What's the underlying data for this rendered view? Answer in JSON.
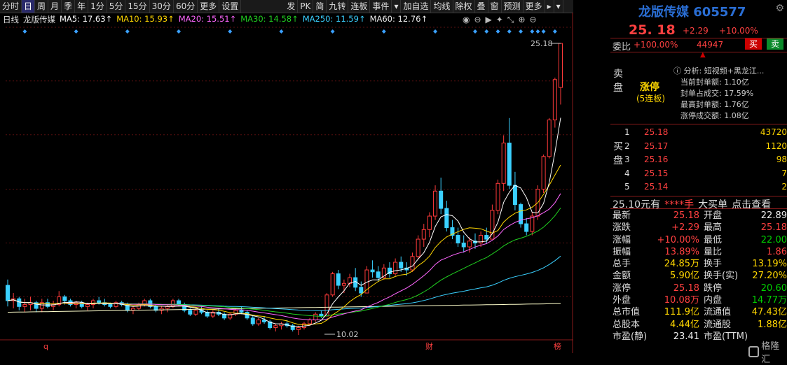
{
  "toolbar": {
    "items": [
      {
        "label": "分时"
      },
      {
        "label": "日",
        "active": true
      },
      {
        "label": "周"
      },
      {
        "label": "月"
      },
      {
        "label": "季"
      },
      {
        "label": "年"
      },
      {
        "label": "1分"
      },
      {
        "label": "5分"
      },
      {
        "label": "15分"
      },
      {
        "label": "30分"
      },
      {
        "label": "60分"
      },
      {
        "label": "更多"
      },
      {
        "label": "设置"
      }
    ],
    "items2": [
      {
        "label": "发"
      },
      {
        "label": "PK"
      },
      {
        "label": "简"
      },
      {
        "label": "九转"
      },
      {
        "label": "连板"
      },
      {
        "label": "事件"
      },
      {
        "label": "▾"
      },
      {
        "label": "加自选"
      },
      {
        "label": "均线"
      },
      {
        "label": "除权"
      },
      {
        "label": "叠"
      },
      {
        "label": "窗"
      },
      {
        "label": "预测"
      },
      {
        "label": "更多"
      },
      {
        "label": "▸"
      },
      {
        "label": "▾"
      }
    ]
  },
  "ma_bar": {
    "period": "日线",
    "stock": "龙版传媒",
    "ma5": "MA5: 17.63↑",
    "ma10": "MA10: 15.93↑",
    "ma20": "MA20: 15.51↑",
    "ma30": "MA30: 14.58↑",
    "ma250": "MA250: 11.59↑",
    "ma60": "MA60: 12.76↑"
  },
  "chart_data": {
    "type": "candlestick",
    "y_ticks": [
      "26.02",
      "23.23",
      "20.43",
      "17.60",
      "14.80",
      "12.01"
    ],
    "ylim": [
      10.02,
      26.02
    ],
    "annotations": {
      "high_label": "25.18",
      "low_label": "10.02",
      "bottom_marks": [
        "q",
        "财",
        "榜"
      ]
    },
    "ohlc": [
      [
        12.6,
        12.9,
        11.5,
        11.8
      ],
      [
        11.8,
        12.2,
        11.4,
        11.9
      ],
      [
        11.9,
        12.0,
        11.3,
        11.5
      ],
      [
        11.5,
        11.9,
        11.2,
        11.6
      ],
      [
        11.6,
        12.0,
        11.3,
        11.7
      ],
      [
        11.7,
        11.8,
        11.2,
        11.4
      ],
      [
        11.4,
        11.9,
        11.2,
        11.7
      ],
      [
        11.7,
        11.9,
        11.4,
        11.5
      ],
      [
        11.5,
        11.8,
        11.3,
        11.6
      ],
      [
        11.6,
        12.3,
        11.5,
        12.0
      ],
      [
        12.0,
        12.1,
        11.6,
        11.8
      ],
      [
        11.8,
        11.9,
        11.5,
        11.6
      ],
      [
        11.6,
        11.8,
        11.4,
        11.7
      ],
      [
        11.7,
        11.8,
        11.4,
        11.5
      ],
      [
        11.5,
        11.7,
        11.3,
        11.6
      ],
      [
        11.6,
        11.9,
        11.4,
        11.8
      ],
      [
        11.8,
        12.0,
        11.6,
        11.7
      ],
      [
        11.7,
        11.9,
        11.5,
        11.6
      ],
      [
        11.6,
        11.7,
        11.4,
        11.5
      ],
      [
        11.5,
        11.8,
        11.4,
        11.7
      ],
      [
        11.7,
        11.8,
        11.5,
        11.6
      ],
      [
        11.6,
        11.7,
        11.2,
        11.3
      ],
      [
        11.3,
        11.5,
        11.1,
        11.4
      ],
      [
        11.4,
        11.7,
        11.3,
        11.6
      ],
      [
        11.6,
        11.9,
        11.5,
        11.8
      ],
      [
        11.8,
        11.9,
        11.4,
        11.5
      ],
      [
        11.5,
        11.6,
        11.2,
        11.3
      ],
      [
        11.3,
        11.5,
        11.1,
        11.4
      ],
      [
        11.4,
        11.6,
        11.2,
        11.5
      ],
      [
        11.5,
        11.9,
        11.4,
        11.8
      ],
      [
        11.8,
        11.9,
        11.5,
        11.6
      ],
      [
        11.6,
        11.7,
        11.2,
        11.3
      ],
      [
        11.3,
        11.4,
        11.0,
        11.1
      ],
      [
        11.1,
        11.4,
        11.0,
        11.3
      ],
      [
        11.3,
        11.5,
        11.1,
        11.2
      ],
      [
        11.2,
        11.3,
        10.9,
        11.0
      ],
      [
        11.0,
        11.3,
        10.9,
        11.2
      ],
      [
        11.2,
        11.4,
        11.0,
        11.1
      ],
      [
        11.1,
        11.2,
        10.8,
        10.9
      ],
      [
        10.9,
        11.2,
        10.8,
        11.1
      ],
      [
        11.1,
        11.4,
        11.0,
        11.3
      ],
      [
        11.3,
        11.5,
        11.1,
        11.2
      ],
      [
        11.2,
        11.3,
        10.8,
        10.9
      ],
      [
        10.9,
        11.0,
        10.5,
        10.6
      ],
      [
        10.6,
        10.9,
        10.5,
        10.8
      ],
      [
        10.8,
        11.0,
        10.6,
        10.7
      ],
      [
        10.7,
        10.8,
        10.3,
        10.4
      ],
      [
        10.4,
        10.6,
        10.2,
        10.5
      ],
      [
        10.5,
        10.7,
        10.3,
        10.6
      ],
      [
        10.6,
        10.8,
        10.4,
        10.5
      ],
      [
        10.5,
        10.6,
        10.2,
        10.3
      ],
      [
        10.3,
        10.5,
        10.02,
        10.4
      ],
      [
        10.4,
        10.7,
        10.3,
        10.6
      ],
      [
        10.6,
        10.9,
        10.5,
        10.8
      ],
      [
        10.8,
        11.2,
        10.7,
        11.1
      ],
      [
        11.1,
        11.3,
        10.9,
        11.0
      ],
      [
        11.0,
        12.2,
        11.0,
        12.1
      ],
      [
        12.1,
        13.3,
        12.0,
        13.2
      ],
      [
        13.2,
        13.4,
        12.4,
        12.6
      ],
      [
        12.6,
        12.9,
        12.2,
        12.7
      ],
      [
        12.7,
        13.2,
        12.5,
        13.0
      ],
      [
        13.0,
        13.5,
        12.3,
        12.5
      ],
      [
        12.5,
        12.8,
        12.0,
        12.2
      ],
      [
        12.2,
        13.6,
        12.2,
        13.4
      ],
      [
        13.4,
        13.9,
        13.0,
        13.3
      ],
      [
        13.3,
        13.6,
        12.8,
        13.0
      ],
      [
        13.0,
        13.7,
        12.9,
        13.5
      ],
      [
        13.5,
        13.8,
        13.0,
        13.2
      ],
      [
        13.2,
        14.0,
        13.1,
        13.8
      ],
      [
        13.8,
        14.1,
        13.3,
        13.5
      ],
      [
        13.5,
        13.8,
        13.1,
        13.4
      ],
      [
        13.4,
        14.3,
        13.3,
        14.1
      ],
      [
        14.1,
        15.2,
        14.0,
        15.0
      ],
      [
        15.0,
        15.8,
        14.6,
        15.5
      ],
      [
        15.5,
        16.4,
        15.1,
        16.2
      ],
      [
        16.2,
        17.8,
        16.0,
        17.5
      ],
      [
        17.5,
        18.2,
        16.3,
        16.6
      ],
      [
        16.6,
        17.0,
        15.4,
        15.6
      ],
      [
        15.6,
        16.0,
        15.0,
        15.2
      ],
      [
        15.2,
        15.6,
        14.6,
        14.8
      ],
      [
        14.8,
        15.2,
        14.3,
        14.6
      ],
      [
        14.6,
        15.1,
        14.3,
        14.9
      ],
      [
        14.9,
        15.3,
        14.5,
        14.8
      ],
      [
        14.8,
        15.4,
        14.6,
        15.2
      ],
      [
        15.2,
        15.6,
        14.8,
        15.0
      ],
      [
        15.0,
        16.8,
        15.0,
        16.5
      ],
      [
        16.5,
        18.1,
        16.3,
        17.9
      ],
      [
        17.9,
        20.4,
        17.5,
        20.0
      ],
      [
        20.0,
        21.3,
        17.6,
        17.8
      ],
      [
        17.8,
        18.5,
        16.5,
        16.8
      ],
      [
        16.8,
        16.9,
        15.6,
        15.8
      ],
      [
        15.8,
        16.1,
        15.2,
        15.4
      ],
      [
        15.4,
        16.4,
        15.2,
        16.2
      ],
      [
        16.2,
        17.8,
        16.0,
        17.6
      ],
      [
        17.6,
        19.4,
        17.4,
        19.3
      ],
      [
        19.3,
        21.3,
        19.2,
        21.2
      ],
      [
        21.2,
        23.4,
        20.8,
        23.3
      ],
      [
        22.89,
        25.18,
        22.0,
        25.18
      ]
    ],
    "ma_colors": {
      "ma5": "#ffffff",
      "ma10": "#ffd700",
      "ma20": "#ff66ff",
      "ma30": "#20d020",
      "ma60": "#3ad0ff",
      "ma250": "#ffffcc"
    }
  },
  "side": {
    "title": "龙版传媒 605577",
    "price": "25. 18",
    "change": "+2.29",
    "pct": "+10.00%",
    "wb_label": "委比",
    "wb_value": "+100.00%",
    "wb_num": "44947",
    "buy_btn": "买",
    "sell_btn": "卖",
    "sell_label": "卖盘",
    "buy_label": "买盘",
    "zt": "涨停",
    "lianban": "(5连板)",
    "analysis": [
      {
        "k": "分析:",
        "v": "短视频+黑龙江..."
      },
      {
        "k": "当前封单额:",
        "v": "1.10亿"
      },
      {
        "k": "封单占成交:",
        "v": "17.59%"
      },
      {
        "k": "最高封单额:",
        "v": "1.76亿"
      },
      {
        "k": "涨停成交额:",
        "v": "1.08亿"
      }
    ],
    "book": [
      {
        "n": "1",
        "p": "25.18",
        "q": "43720"
      },
      {
        "n": "2",
        "p": "25.17",
        "q": "1120"
      },
      {
        "n": "3",
        "p": "25.16",
        "q": "98"
      },
      {
        "n": "4",
        "p": "25.15",
        "q": "7"
      },
      {
        "n": "5",
        "p": "25.14",
        "q": "2"
      }
    ],
    "sum": {
      "a": "25.10元有",
      "b": "****手",
      "c": "大买单",
      "d": "点击查看"
    },
    "stats": [
      {
        "l": "最新",
        "v": "25.18",
        "vc": "red",
        "l2": "开盘",
        "v2": "22.89",
        "v2c": "wht"
      },
      {
        "l": "涨跌",
        "v": "+2.29",
        "vc": "red",
        "l2": "最高",
        "v2": "25.18",
        "v2c": "red"
      },
      {
        "l": "涨幅",
        "v": "+10.00%",
        "vc": "red",
        "l2": "最低",
        "v2": "22.00",
        "v2c": "grn"
      },
      {
        "l": "振幅",
        "v": "13.89%",
        "vc": "red",
        "l2": "量比",
        "v2": "1.86",
        "v2c": "red"
      },
      {
        "l": "总手",
        "v": "24.85万",
        "vc": "yel",
        "l2": "换手",
        "v2": "13.19%",
        "v2c": "yel"
      },
      {
        "l": "金额",
        "v": "5.90亿",
        "vc": "yel",
        "l2": "换手(实)",
        "v2": "27.20%",
        "v2c": "yel"
      },
      {
        "l": "涨停",
        "v": "25.18",
        "vc": "red",
        "l2": "跌停",
        "v2": "20.60",
        "v2c": "grn"
      },
      {
        "l": "外盘",
        "v": "10.08万",
        "vc": "red",
        "l2": "内盘",
        "v2": "14.77万",
        "v2c": "grn"
      },
      {
        "l": "总市值",
        "v": "111.9亿",
        "vc": "yel",
        "l2": "流通值",
        "v2": "47.43亿",
        "v2c": "yel"
      },
      {
        "l": "总股本",
        "v": "4.44亿",
        "vc": "yel",
        "l2": "流通股",
        "v2": "1.88亿",
        "v2c": "yel"
      },
      {
        "l": "市盈(静)",
        "v": "23.41",
        "vc": "wht",
        "l2": "市盈(TTM)",
        "v2": "",
        "v2c": "wht"
      }
    ],
    "watermark": "格隆汇"
  }
}
